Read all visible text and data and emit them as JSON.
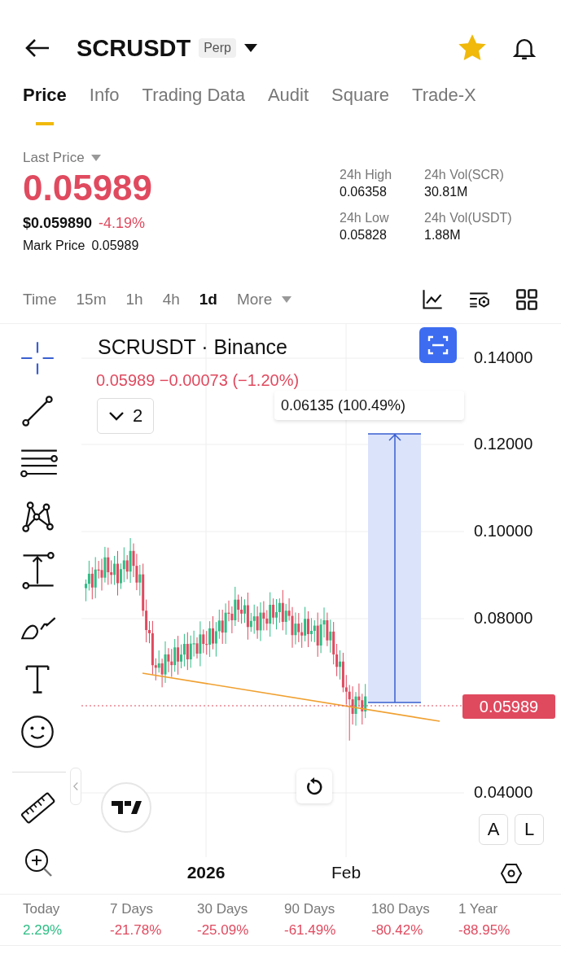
{
  "header": {
    "title": "SCRUSDT",
    "badge": "Perp",
    "favorite": true
  },
  "tabs": [
    {
      "label": "Price",
      "selected": true
    },
    {
      "label": "Info",
      "selected": false
    },
    {
      "label": "Trading Data",
      "selected": false
    },
    {
      "label": "Audit",
      "selected": false
    },
    {
      "label": "Square",
      "selected": false
    },
    {
      "label": "Trade-X",
      "selected": false
    }
  ],
  "price": {
    "label": "Last Price",
    "value": "0.05989",
    "usd": "$0.059890",
    "change": "-4.19%",
    "mark_label": "Mark Price",
    "mark_value": "0.05989"
  },
  "stats": [
    {
      "label": "24h High",
      "value": "0.06358"
    },
    {
      "label": "24h Vol(SCR)",
      "value": "30.81M"
    },
    {
      "label": "24h Low",
      "value": "0.05828"
    },
    {
      "label": "24h Vol(USDT)",
      "value": "1.88M"
    }
  ],
  "intervals": [
    {
      "label": "Time",
      "selected": false
    },
    {
      "label": "15m",
      "selected": false
    },
    {
      "label": "1h",
      "selected": false
    },
    {
      "label": "4h",
      "selected": false
    },
    {
      "label": "1d",
      "selected": true
    }
  ],
  "more": {
    "label": "More"
  },
  "chart": {
    "legend_title": "SCRUSDT · Binance",
    "legend_values": "0.05989 −0.00073 (−1.20%)",
    "indicator_count": "2",
    "measure_label": "0.06135 (100.49%)",
    "price_ticks": [
      "0.14000",
      "0.12000",
      "0.10000",
      "0.08000",
      "0.04000"
    ],
    "current_price": "0.05989",
    "time_labels": [
      "2026",
      "Feb"
    ],
    "scale_buttons": [
      "A",
      "L"
    ]
  },
  "periods": [
    {
      "label": "Today",
      "value": "2.29%",
      "color": "#2ebd85"
    },
    {
      "label": "7 Days",
      "value": "-21.78%",
      "color": "#e04a5f"
    },
    {
      "label": "30 Days",
      "value": "-25.09%",
      "color": "#e04a5f"
    },
    {
      "label": "90 Days",
      "value": "-61.49%",
      "color": "#e04a5f"
    },
    {
      "label": "180 Days",
      "value": "-80.42%",
      "color": "#e04a5f"
    },
    {
      "label": "1 Year",
      "value": "-88.95%",
      "color": "#e04a5f"
    }
  ]
}
